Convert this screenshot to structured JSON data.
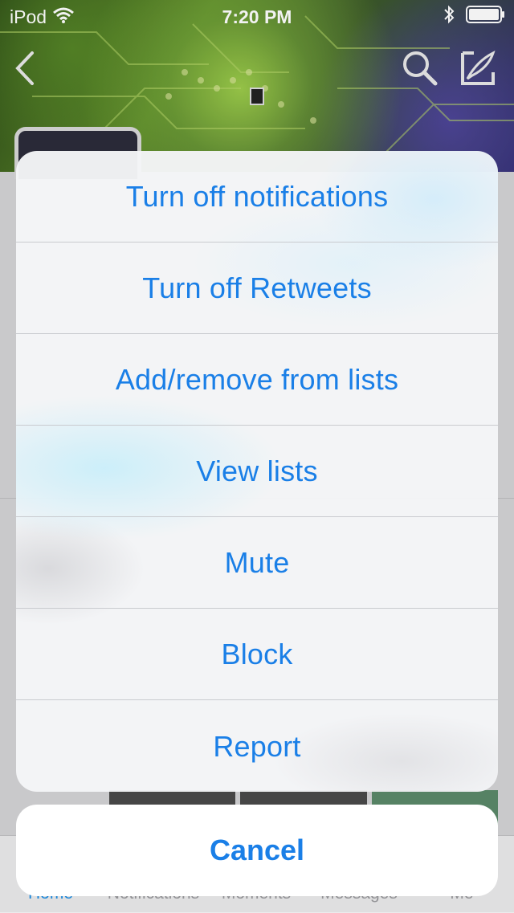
{
  "status_bar": {
    "device": "iPod",
    "time": "7:20 PM"
  },
  "icons": {
    "wifi": "wifi-icon",
    "bluetooth": "bluetooth-icon",
    "battery": "battery-icon",
    "back": "chevron-left-icon",
    "search": "search-icon",
    "compose": "compose-icon"
  },
  "action_sheet": {
    "items": [
      {
        "label": "Turn off notifications"
      },
      {
        "label": "Turn off Retweets"
      },
      {
        "label": "Add/remove from lists"
      },
      {
        "label": "View lists"
      },
      {
        "label": "Mute"
      },
      {
        "label": "Block"
      },
      {
        "label": "Report"
      }
    ],
    "cancel_label": "Cancel"
  },
  "tab_bar": {
    "items": [
      {
        "label": "Home"
      },
      {
        "label": "Notifications"
      },
      {
        "label": "Moments"
      },
      {
        "label": "Messages"
      },
      {
        "label": "Me"
      }
    ],
    "active_tab": "Home"
  },
  "colors": {
    "accent": "#1a7fe7",
    "tab_active": "#1d8fe6"
  }
}
